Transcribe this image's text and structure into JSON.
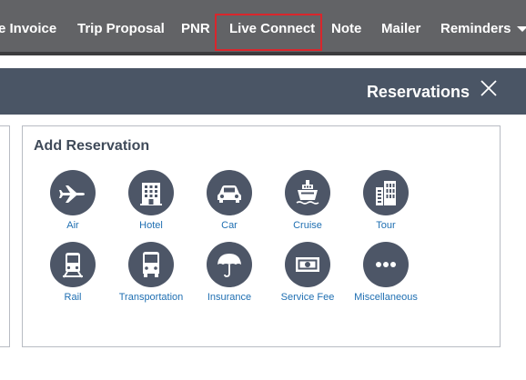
{
  "nav": {
    "items": [
      {
        "label": "e Invoice"
      },
      {
        "label": "Trip Proposal"
      },
      {
        "label": "PNR"
      },
      {
        "label": "Live Connect"
      },
      {
        "label": "Note"
      },
      {
        "label": "Mailer"
      },
      {
        "label": "Reminders"
      }
    ],
    "highlighted_item": "Live Connect",
    "highlight_color": "#d9262c"
  },
  "header": {
    "title": "Reservations",
    "close_icon": "close-icon"
  },
  "add_reservation": {
    "title": "Add Reservation",
    "tiles": [
      {
        "label": "Air",
        "icon": "airplane-icon"
      },
      {
        "label": "Hotel",
        "icon": "building-icon"
      },
      {
        "label": "Car",
        "icon": "car-icon"
      },
      {
        "label": "Cruise",
        "icon": "ship-icon"
      },
      {
        "label": "Tour",
        "icon": "city-icon"
      },
      {
        "label": "Rail",
        "icon": "train-icon"
      },
      {
        "label": "Transportation",
        "icon": "bus-icon"
      },
      {
        "label": "Insurance",
        "icon": "umbrella-icon"
      },
      {
        "label": "Service Fee",
        "icon": "money-icon"
      },
      {
        "label": "Miscellaneous",
        "icon": "more-icon"
      }
    ]
  },
  "colors": {
    "nav_bg": "#626366",
    "header_bg": "#4a5565",
    "icon_circle": "#4d5667",
    "link_text": "#1f6fb2"
  }
}
